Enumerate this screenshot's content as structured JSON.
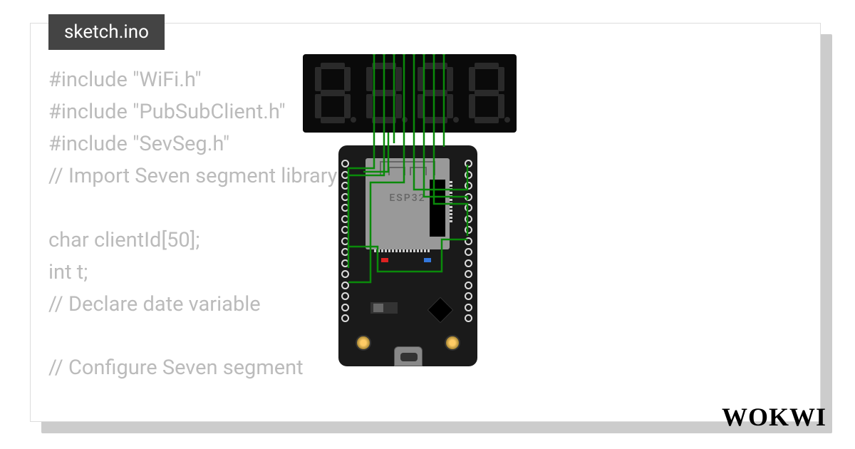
{
  "tab": {
    "title": "sketch.ino"
  },
  "code": {
    "line1": "#include \"WiFi.h\"",
    "line2": "#include \"PubSubClient.h\"",
    "line3": "#include \"SevSeg.h\"",
    "line4": "// Import Seven segment library",
    "line5": "",
    "line6": "char clientId[50];",
    "line7": "int t;",
    "line8": "// Declare date variable",
    "line9": "",
    "line10": "// Configure Seven segment"
  },
  "board": {
    "label": "ESP32"
  },
  "logo": {
    "text": "WOKWI"
  },
  "colors": {
    "wire": "#0a8a0a"
  }
}
